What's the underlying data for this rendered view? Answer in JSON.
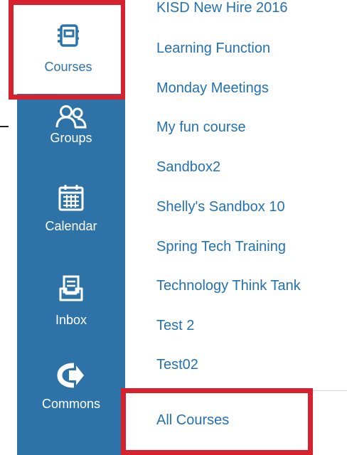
{
  "global_nav": {
    "items": [
      {
        "label": "Courses",
        "icon": "courses-notebook-icon",
        "active": true
      },
      {
        "label": "Groups",
        "icon": "groups-people-icon",
        "active": false
      },
      {
        "label": "Calendar",
        "icon": "calendar-icon",
        "active": false
      },
      {
        "label": "Inbox",
        "icon": "inbox-tray-icon",
        "active": false
      },
      {
        "label": "Commons",
        "icon": "commons-arrow-icon",
        "active": false
      }
    ]
  },
  "course_tray": {
    "courses": [
      "KISD New Hire 2016",
      "Learning Function",
      "Monday Meetings",
      "My fun course",
      "Sandbox2",
      "Shelly's Sandbox 10",
      "Spring Tech Training",
      "Technology Think Tank",
      "Test 2",
      "Test02"
    ],
    "all_courses_label": "All Courses"
  },
  "colors": {
    "nav_background": "#2d73a8",
    "link": "#2471b0",
    "highlight_box": "#d6212f"
  }
}
